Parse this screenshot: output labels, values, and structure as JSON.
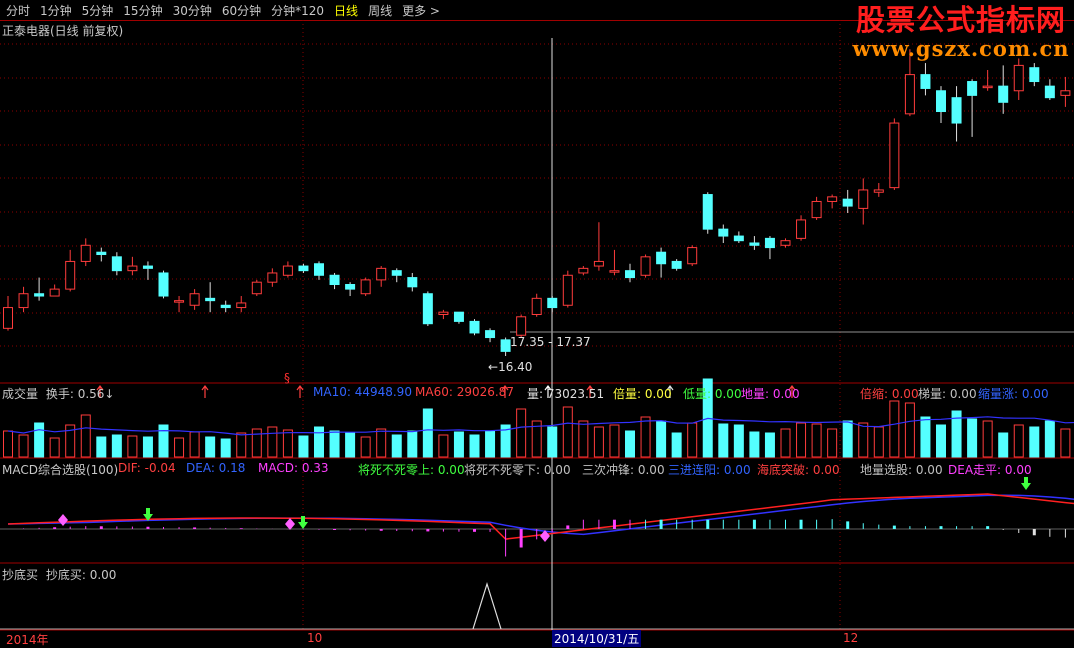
{
  "tabs": [
    {
      "label": "分时",
      "active": false
    },
    {
      "label": "1分钟",
      "active": false
    },
    {
      "label": "5分钟",
      "active": false
    },
    {
      "label": "15分钟",
      "active": false
    },
    {
      "label": "30分钟",
      "active": false
    },
    {
      "label": "60分钟",
      "active": false
    },
    {
      "label": "分钟*120",
      "active": false
    },
    {
      "label": "日线",
      "active": true
    },
    {
      "label": "周线",
      "active": false
    },
    {
      "label": "更多 >",
      "active": false
    }
  ],
  "stock_title": "正泰电器(日线 前复权)",
  "logo": {
    "title": "股票公式指标网",
    "url": "www.gszx.com.cn"
  },
  "price_labels": {
    "range": "17.35 - 17.37",
    "low": "16.40"
  },
  "marker_s": "§",
  "volume_panel": {
    "name": "成交量",
    "turnover": "换手: 0.56↓",
    "ma10": "MA10: 44948.90",
    "ma60": "MA60: 29026.87",
    "vol": "量: 73023.51",
    "beiliang": "倍量: 0.00",
    "diliang": "低量: 0.00",
    "diliang2": "地量: 0.00",
    "beisuo": "倍缩: 0.00",
    "tiliang": "梯量: 0.00",
    "suoliang": "缩量涨: 0.00"
  },
  "macd_panel": {
    "name": "MACD综合选股(100)",
    "dif": "DIF: -0.04",
    "dea": "DEA: 0.18",
    "macd": "MACD: 0.33",
    "jsbs": "将死不死零上: 0.00",
    "jsbx": "将死不死零下: 0.00",
    "sc": "三次冲锋: 0.00",
    "sjlb": "三进连阳: 0.00",
    "hcjp": "海底突破: 0.00",
    "dlxg": "地量选股: 0.00",
    "deazp": "DEA走平: 0.00"
  },
  "bottom_panel": {
    "name": "抄底买",
    "value": "抄底买: 0.00"
  },
  "dates": {
    "year": "2014年",
    "oct": "10",
    "cursor": "2014/10/31/五",
    "dec": "12"
  },
  "colors": {
    "up": "#ff3c3c",
    "down": "#54ffff",
    "grid": "#8b0000",
    "dif": "#3232ff",
    "dea": "#ff2020",
    "cursor": "#e0e0e0"
  },
  "chart_data": {
    "type": "candlestick",
    "candles": [
      [
        16.6,
        17.05,
        16.55,
        17.3
      ],
      [
        17.05,
        17.35,
        16.95,
        17.5
      ],
      [
        17.35,
        17.3,
        17.2,
        17.7
      ],
      [
        17.3,
        17.45,
        17.3,
        17.55
      ],
      [
        17.45,
        18.05,
        17.4,
        18.3
      ],
      [
        18.05,
        18.4,
        17.95,
        18.55
      ],
      [
        18.25,
        18.2,
        18.05,
        18.35
      ],
      [
        18.15,
        17.85,
        17.75,
        18.25
      ],
      [
        17.85,
        17.95,
        17.75,
        18.15
      ],
      [
        17.95,
        17.9,
        17.65,
        18.05
      ],
      [
        17.8,
        17.3,
        17.25,
        17.85
      ],
      [
        17.2,
        17.2,
        16.95,
        17.3
      ],
      [
        17.1,
        17.35,
        17.0,
        17.45
      ],
      [
        17.25,
        17.2,
        16.95,
        17.6
      ],
      [
        17.1,
        17.05,
        16.95,
        17.2
      ],
      [
        17.05,
        17.15,
        16.95,
        17.3
      ],
      [
        17.35,
        17.6,
        17.3,
        17.65
      ],
      [
        17.6,
        17.8,
        17.5,
        17.9
      ],
      [
        17.75,
        17.95,
        17.7,
        18.05
      ],
      [
        17.95,
        17.85,
        17.8,
        18.0
      ],
      [
        18.0,
        17.75,
        17.65,
        18.05
      ],
      [
        17.75,
        17.55,
        17.45,
        17.8
      ],
      [
        17.55,
        17.45,
        17.3,
        17.6
      ],
      [
        17.35,
        17.65,
        17.3,
        17.7
      ],
      [
        17.65,
        17.9,
        17.5,
        17.95
      ],
      [
        17.85,
        17.75,
        17.6,
        17.9
      ],
      [
        17.7,
        17.5,
        17.4,
        17.8
      ],
      [
        17.35,
        16.7,
        16.65,
        17.4
      ],
      [
        16.9,
        16.95,
        16.8,
        17.0
      ],
      [
        16.95,
        16.75,
        16.7,
        16.95
      ],
      [
        16.75,
        16.5,
        16.45,
        16.8
      ],
      [
        16.55,
        16.4,
        16.3,
        16.6
      ],
      [
        16.35,
        16.1,
        16.0,
        16.4
      ],
      [
        16.45,
        16.85,
        16.4,
        16.9
      ],
      [
        16.9,
        17.25,
        16.85,
        17.35
      ],
      [
        17.25,
        17.05,
        16.95,
        17.3
      ],
      [
        17.1,
        17.75,
        17.05,
        17.85
      ],
      [
        17.8,
        17.9,
        17.75,
        17.95
      ],
      [
        17.95,
        18.05,
        17.85,
        18.9
      ],
      [
        17.85,
        17.85,
        17.75,
        18.3
      ],
      [
        17.85,
        17.7,
        17.6,
        18.0
      ],
      [
        17.75,
        18.15,
        17.7,
        18.2
      ],
      [
        18.25,
        18.0,
        17.7,
        18.35
      ],
      [
        18.05,
        17.9,
        17.85,
        18.1
      ],
      [
        18.0,
        18.35,
        17.95,
        18.4
      ],
      [
        19.5,
        18.75,
        18.65,
        19.55
      ],
      [
        18.75,
        18.6,
        18.45,
        18.85
      ],
      [
        18.6,
        18.5,
        18.45,
        18.7
      ],
      [
        18.45,
        18.4,
        18.3,
        18.6
      ],
      [
        18.55,
        18.35,
        18.1,
        18.6
      ],
      [
        18.4,
        18.5,
        18.35,
        18.55
      ],
      [
        18.55,
        18.95,
        18.5,
        19.05
      ],
      [
        19.0,
        19.35,
        18.95,
        19.45
      ],
      [
        19.35,
        19.45,
        19.2,
        19.5
      ],
      [
        19.4,
        19.25,
        19.1,
        19.6
      ],
      [
        19.2,
        19.6,
        18.85,
        19.85
      ],
      [
        19.55,
        19.6,
        19.45,
        19.75
      ],
      [
        19.65,
        21.05,
        19.6,
        21.15
      ],
      [
        21.25,
        22.1,
        21.2,
        22.65
      ],
      [
        22.1,
        21.8,
        21.65,
        22.35
      ],
      [
        21.75,
        21.3,
        21.05,
        21.85
      ],
      [
        21.6,
        21.05,
        20.65,
        21.85
      ],
      [
        21.95,
        21.65,
        20.75,
        22.0
      ],
      [
        21.85,
        21.85,
        21.75,
        22.2
      ],
      [
        21.85,
        21.5,
        21.25,
        22.3
      ],
      [
        21.75,
        22.3,
        21.55,
        22.45
      ],
      [
        22.25,
        21.95,
        21.85,
        22.35
      ],
      [
        21.85,
        21.6,
        21.55,
        22.0
      ],
      [
        21.65,
        21.75,
        21.4,
        22.05
      ],
      [
        21.6,
        21.35,
        21.25,
        21.8
      ],
      [
        21.25,
        20.85,
        20.55,
        21.35
      ]
    ]
  }
}
